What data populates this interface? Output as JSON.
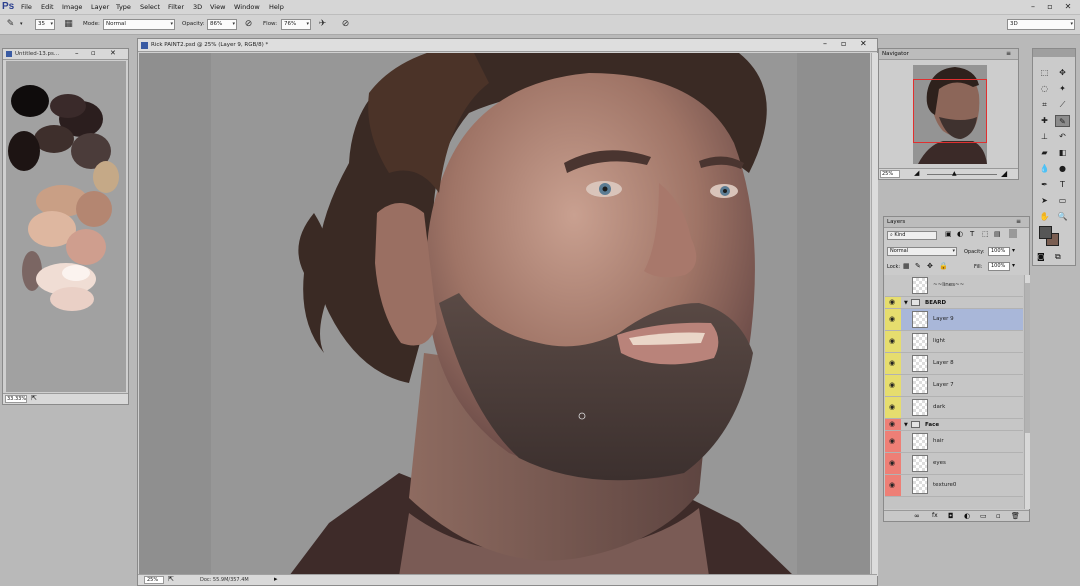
{
  "app": {
    "logo": "Ps",
    "workspace": "3D"
  },
  "menu": [
    "File",
    "Edit",
    "Image",
    "Layer",
    "Type",
    "Select",
    "Filter",
    "3D",
    "View",
    "Window",
    "Help"
  ],
  "options": {
    "brush_size": "35",
    "mode_label": "Mode:",
    "mode_value": "Normal",
    "opacity_label": "Opacity:",
    "opacity_value": "86%",
    "flow_label": "Flow:",
    "flow_value": "76%"
  },
  "swatch_doc": {
    "title": "Untitled-13.ps...",
    "zoom": "33.33%"
  },
  "main_doc": {
    "title": "Rick PAINT2.psd @ 25% (Layer 9, RGB/8) *",
    "zoom": "25%",
    "doc_size": "Doc: 55.9M/357.4M"
  },
  "navigator": {
    "title": "Navigator",
    "zoom": "25%"
  },
  "layers": {
    "title": "Layers",
    "filter_kind": "Kind",
    "blend_mode": "Normal",
    "opacity_label": "Opacity:",
    "opacity_value": "100%",
    "lock_label": "Lock:",
    "fill_label": "Fill:",
    "fill_value": "100%",
    "rows": [
      {
        "type": "layer",
        "name": "~~lines~~",
        "visible": false,
        "color": "none",
        "selected": false
      },
      {
        "type": "group",
        "name": "BEARD",
        "color": "#e6dd6e"
      },
      {
        "type": "layer",
        "name": "Layer 9",
        "visible": true,
        "color": "#e6dd6e",
        "selected": true
      },
      {
        "type": "layer",
        "name": "light",
        "visible": true,
        "color": "#e6dd6e",
        "selected": false
      },
      {
        "type": "layer",
        "name": "Layer 8",
        "visible": true,
        "color": "#e6dd6e",
        "selected": false
      },
      {
        "type": "layer",
        "name": "Layer 7",
        "visible": true,
        "color": "#e6dd6e",
        "selected": false
      },
      {
        "type": "layer",
        "name": "dark",
        "visible": true,
        "color": "#e6dd6e",
        "selected": false
      },
      {
        "type": "group",
        "name": "Face",
        "color": "#ee7f76"
      },
      {
        "type": "layer",
        "name": "hair",
        "visible": true,
        "color": "#ee7f76",
        "selected": false
      },
      {
        "type": "layer",
        "name": "eyes",
        "visible": true,
        "color": "#ee7f76",
        "selected": false
      },
      {
        "type": "layer",
        "name": "texture0",
        "visible": true,
        "color": "#ee7f76",
        "selected": false
      }
    ]
  },
  "colors": {
    "foreground": "#565656",
    "background": "#7a5e52",
    "selected_row": "#a9b7d9"
  }
}
